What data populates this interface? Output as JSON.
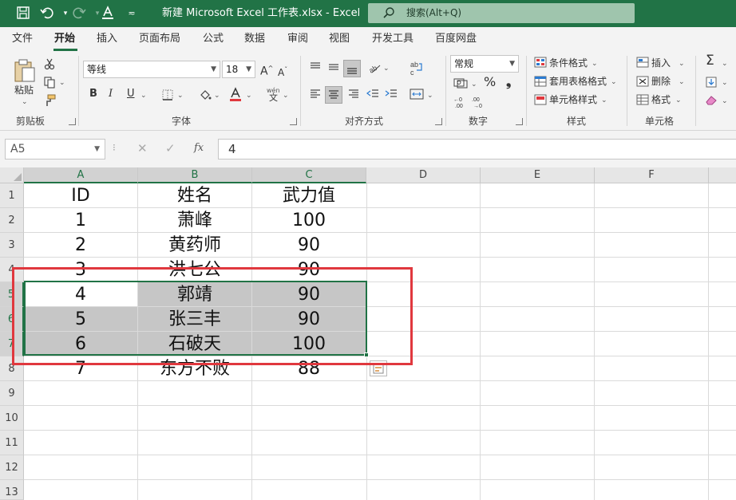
{
  "window": {
    "title": "新建 Microsoft Excel 工作表.xlsx  -  Excel",
    "search_placeholder": "搜索(Alt+Q)"
  },
  "tabs": [
    "文件",
    "开始",
    "插入",
    "页面布局",
    "公式",
    "数据",
    "审阅",
    "视图",
    "开发工具",
    "百度网盘"
  ],
  "active_tab": "开始",
  "ribbon": {
    "clipboard": {
      "label": "剪贴板",
      "paste": "粘贴"
    },
    "font": {
      "label": "字体",
      "font_name": "等线",
      "font_size": "18",
      "bold": "B",
      "italic": "I",
      "underline": "U",
      "wen": "wén",
      "wen_char": "文"
    },
    "alignment": {
      "label": "对齐方式"
    },
    "number": {
      "label": "数字",
      "format": "常规",
      "percent": "%",
      "comma": "❟"
    },
    "styles": {
      "label": "样式",
      "conditional": "条件格式",
      "table_format": "套用表格格式",
      "cell_style": "单元格样式"
    },
    "cells": {
      "label": "单元格",
      "insert": "插入",
      "delete": "删除",
      "format": "格式"
    },
    "editing": {
      "sum": "Σ"
    }
  },
  "formula_bar": {
    "name_box": "A5",
    "formula": "4",
    "fx": "fx"
  },
  "sheet": {
    "columns": [
      "A",
      "B",
      "C",
      "D",
      "E",
      "F"
    ],
    "rows": [
      "1",
      "2",
      "3",
      "4",
      "5",
      "6",
      "7",
      "8",
      "9",
      "10",
      "11",
      "12",
      "13"
    ],
    "cells": [
      [
        "ID",
        "姓名",
        "武力值"
      ],
      [
        "1",
        "萧峰",
        "100"
      ],
      [
        "2",
        "黄药师",
        "90"
      ],
      [
        "3",
        "洪七公",
        "90"
      ],
      [
        "4",
        "郭靖",
        "90"
      ],
      [
        "5",
        "张三丰",
        "90"
      ],
      [
        "6",
        "石破天",
        "100"
      ],
      [
        "7",
        "东方不败",
        "88"
      ]
    ],
    "selected_range": "A5:C7",
    "active_cell": "A5"
  },
  "colors": {
    "accent": "#217346",
    "highlight_box": "#e0383e",
    "selection_fill": "#c6c6c6"
  }
}
